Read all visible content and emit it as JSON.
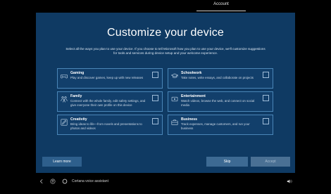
{
  "topbar": {
    "tab_label": "Account"
  },
  "title": "Customize your device",
  "subtitle": "Select all the ways you plan to use your device. If you choose to tell Microsoft how you plan to use your device, we'll customize suggestions for tools and services during device setup and your welcome experience.",
  "cards": [
    {
      "title": "Gaming",
      "desc": "Play and discover games, keep up with new releases",
      "icon": "gamepad-icon",
      "checked": false
    },
    {
      "title": "Schoolwork",
      "desc": "Take notes, write essays, and collaborate on projects",
      "icon": "graduation-cap-icon",
      "checked": false
    },
    {
      "title": "Family",
      "desc": "Connect with the whole family, edit safety settings, and give everyone their own profile on this device",
      "icon": "family-icon",
      "checked": false
    },
    {
      "title": "Entertainment",
      "desc": "Watch videos, browse the web, and connect on social media",
      "icon": "media-icon",
      "checked": false
    },
    {
      "title": "Creativity",
      "desc": "Bring ideas to life—from novels and presentations to photos and videos",
      "icon": "pen-icon",
      "checked": false
    },
    {
      "title": "Business",
      "desc": "Track expenses, manage customers, and run your business",
      "icon": "briefcase-icon",
      "checked": false
    }
  ],
  "buttons": {
    "learn_more": "Learn more",
    "skip": "Skip",
    "accept": "Accept"
  },
  "bottombar": {
    "cortana_label": "Cortana voice assistant"
  }
}
